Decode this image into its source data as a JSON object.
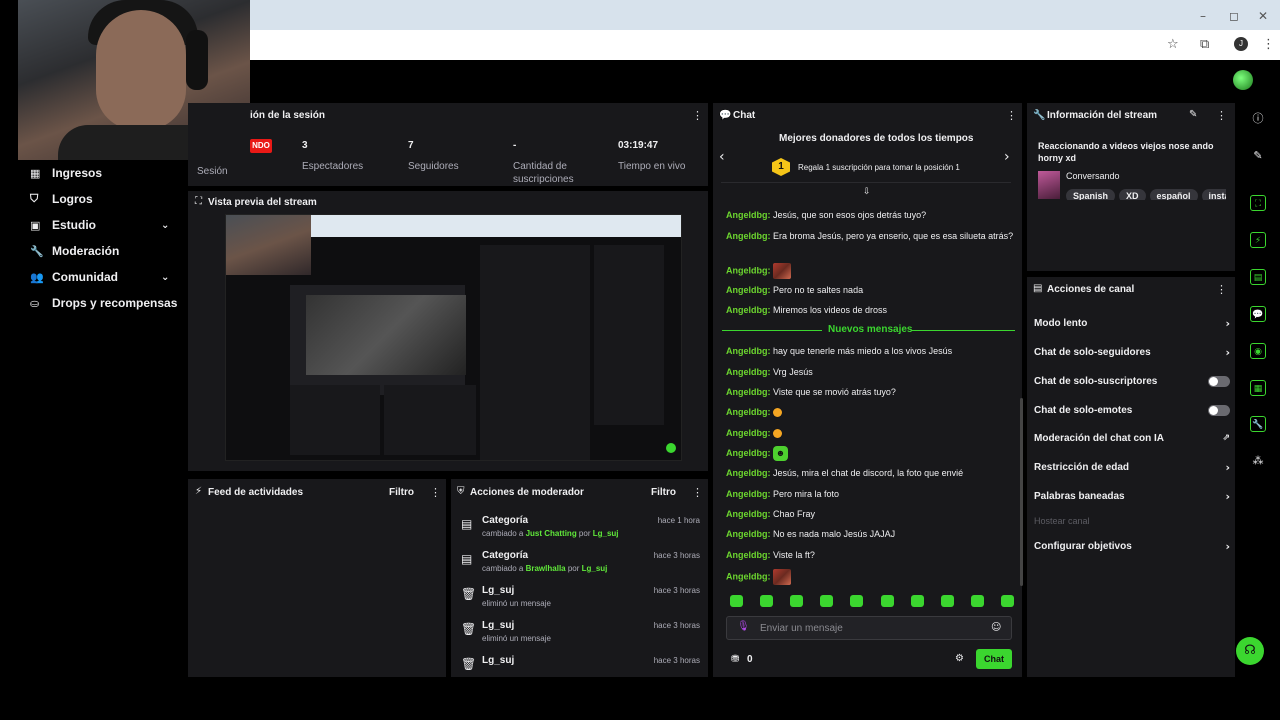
{
  "colors": {
    "accent": "#3bd62f",
    "live_red": "#e91916",
    "panel": "#18181b",
    "bg": "#000000"
  },
  "browser": {
    "window_controls": [
      "–",
      "◻",
      "✕"
    ],
    "toolbar_icons": [
      "star-icon",
      "extensions-icon",
      "profile-icon",
      "menu-icon"
    ],
    "profile_initial": "J"
  },
  "sidebar": {
    "items": [
      {
        "label": "Ingresos",
        "icon": "revenue-icon",
        "expandable": false
      },
      {
        "label": "Logros",
        "icon": "achievements-icon",
        "expandable": false
      },
      {
        "label": "Estudio",
        "icon": "studio-icon",
        "expandable": true
      },
      {
        "label": "Moderación",
        "icon": "wrench-icon",
        "expandable": false
      },
      {
        "label": "Comunidad",
        "icon": "community-icon",
        "expandable": true
      },
      {
        "label": "Drops y recompensas",
        "icon": "drops-icon",
        "expandable": false
      }
    ]
  },
  "session": {
    "title": "ión de la sesión",
    "badge": "NDO",
    "first_label": "Sesión",
    "stats": [
      {
        "value": "3",
        "label": "Espectadores"
      },
      {
        "value": "7",
        "label": "Seguidores"
      },
      {
        "value": "-",
        "label": "Cantidad de suscripciones"
      },
      {
        "value": "03:19:47",
        "label": "Tiempo en vivo"
      }
    ]
  },
  "preview": {
    "title": "Vista previa del stream"
  },
  "activity": {
    "title": "Feed de actividades",
    "filter": "Filtro"
  },
  "mod_actions": {
    "title": "Acciones de moderador",
    "filter": "Filtro",
    "entries": [
      {
        "icon": "category-icon",
        "title": "Categoría",
        "pre": "cambiado a ",
        "target": "Just Chatting",
        "mid": " por ",
        "user": "Lg_suj",
        "time": "hace 1 hora"
      },
      {
        "icon": "category-icon",
        "title": "Categoría",
        "pre": "cambiado a ",
        "target": "Brawlhalla",
        "mid": " por ",
        "user": "Lg_suj",
        "time": "hace 3 horas"
      },
      {
        "icon": "trash-icon",
        "title": "Lg_suj",
        "pre": "eliminó un mensaje",
        "target": "",
        "mid": "",
        "user": "",
        "time": "hace 3 horas"
      },
      {
        "icon": "trash-icon",
        "title": "Lg_suj",
        "pre": "eliminó un mensaje",
        "target": "",
        "mid": "",
        "user": "",
        "time": "hace 3 horas"
      },
      {
        "icon": "trash-icon",
        "title": "Lg_suj",
        "pre": "",
        "target": "",
        "mid": "",
        "user": "",
        "time": "hace 3 horas"
      }
    ]
  },
  "chat": {
    "title": "Chat",
    "top_donors_title": "Mejores donadores de todos los tiempos",
    "top_donors_rank": "1",
    "top_donors_text": "Regala 1 suscripción para tomar la posición 1",
    "new_messages": "Nuevos mensajes",
    "messages_before": [
      {
        "user": "Angeldbg:",
        "text": "Jesús, que son esos ojos detrás tuyo?"
      },
      {
        "user": "Angeldbg:",
        "text": "Era broma Jesús, pero ya enserio, que es esa silueta atrás?"
      },
      {
        "user": "Angeldbg:",
        "text": "",
        "emote": "image"
      },
      {
        "user": "Angeldbg:",
        "text": "Pero no te saltes nada"
      },
      {
        "user": "Angeldbg:",
        "text": "Miremos los videos de dross"
      }
    ],
    "messages_after": [
      {
        "user": "Angeldbg:",
        "text": "hay que tenerle más miedo a los vivos Jesús"
      },
      {
        "user": "Angeldbg:",
        "text": "Vrg Jesús"
      },
      {
        "user": "Angeldbg:",
        "text": "Viste que se movió atrás tuyo?"
      },
      {
        "user": "Angeldbg:",
        "text": "",
        "emote": "emoji"
      },
      {
        "user": "Angeldbg:",
        "text": "",
        "emote": "emoji"
      },
      {
        "user": "Angeldbg:",
        "text": "",
        "emote": "green"
      },
      {
        "user": "Angeldbg:",
        "text": "Jesús, mira el chat de discord, la foto que envié"
      },
      {
        "user": "Angeldbg:",
        "text": "Pero mira la foto"
      },
      {
        "user": "Angeldbg:",
        "text": "Chao Fray"
      },
      {
        "user": "Angeldbg:",
        "text": "No es nada malo Jesús JAJAJ"
      },
      {
        "user": "Angeldbg:",
        "text": "Viste la ft?"
      },
      {
        "user": "Angeldbg:",
        "text": "",
        "emote": "image"
      }
    ],
    "input_placeholder": "Enviar un mensaje",
    "points": "0",
    "send_label": "Chat"
  },
  "stream_info": {
    "title": "Información del stream",
    "stream_title": "Reaccionando a videos viejos nose ando horny xd",
    "category": "Conversando",
    "tags": [
      "Spanish",
      "XD",
      "español",
      "instag"
    ]
  },
  "channel_actions": {
    "title": "Acciones de canal",
    "rows": [
      {
        "label": "Modo lento",
        "control": "arrow"
      },
      {
        "label": "Chat de solo-seguidores",
        "control": "arrow"
      },
      {
        "label": "Chat de solo-suscriptores",
        "control": "toggle"
      },
      {
        "label": "Chat de solo-emotes",
        "control": "toggle"
      },
      {
        "label": "Moderación del chat con IA",
        "control": "external"
      },
      {
        "label": "Restricción de edad",
        "control": "arrow"
      },
      {
        "label": "Palabras baneadas",
        "control": "arrow"
      },
      {
        "label": "Hostear canal",
        "control": "none",
        "disabled": true
      },
      {
        "label": "Configurar objetivos",
        "control": "arrow"
      }
    ]
  },
  "rail": {
    "icons": [
      "info-icon",
      "edit-icon",
      "clip-icon",
      "lightning-icon",
      "notes-icon",
      "chat-icon",
      "broadcast-icon",
      "layout-icon",
      "wrench-icon",
      "extensions-icon"
    ]
  }
}
